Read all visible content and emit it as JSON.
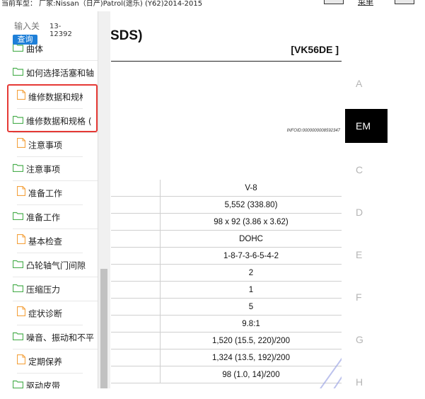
{
  "header": {
    "vehicle_text": "当前车型：  厂家:Nissan（日产)Patrol(途乐) (Y62)2014-2015",
    "toolbar_link": "菜单"
  },
  "search": {
    "placeholder": "输入关",
    "button": "查询",
    "code": "13-12392"
  },
  "tree": [
    {
      "label": "曲体",
      "type": "folder"
    },
    {
      "label": "如何选择活塞和轴",
      "type": "folder"
    },
    {
      "label": "维修数据和规格",
      "type": "file",
      "highlighted": true
    },
    {
      "label": "维修数据和规格 (",
      "type": "folder",
      "highlighted": true
    },
    {
      "label": "注意事项",
      "type": "file"
    },
    {
      "label": "注意事项",
      "type": "folder"
    },
    {
      "label": "准备工作",
      "type": "file"
    },
    {
      "label": "准备工作",
      "type": "folder"
    },
    {
      "label": "基本检查",
      "type": "file"
    },
    {
      "label": "凸轮轴气门间隙",
      "type": "folder"
    },
    {
      "label": "压缩压力",
      "type": "folder"
    },
    {
      "label": "症状诊断",
      "type": "file"
    },
    {
      "label": "噪音、振动和不平",
      "type": "folder"
    },
    {
      "label": "定期保养",
      "type": "file"
    },
    {
      "label": "驱动皮带",
      "type": "folder"
    }
  ],
  "document": {
    "title": "SDS)",
    "engine": "[VK56DE ]",
    "infoid": "INFOID:0000000008592347",
    "spec_values": [
      "V-8",
      "5,552 (338.80)",
      "98 x 92 (3.86 x 3.62)",
      "DOHC",
      "1-8-7-3-6-5-4-2",
      "2",
      "1",
      "5",
      "9.8:1",
      "1,520 (15.5, 220)/200",
      "1,324 (13.5, 192)/200",
      "98 (1.0, 14)/200"
    ]
  },
  "section_index": {
    "letters": [
      "A",
      "EM",
      "C",
      "D",
      "E",
      "F",
      "G",
      "H"
    ],
    "active": "EM"
  },
  "colors": {
    "highlight": "#e53935",
    "search_button": "#1e7fd8",
    "folder_icon": "#4caf50",
    "file_icon": "#f4a340",
    "active_tab": "#000000"
  }
}
